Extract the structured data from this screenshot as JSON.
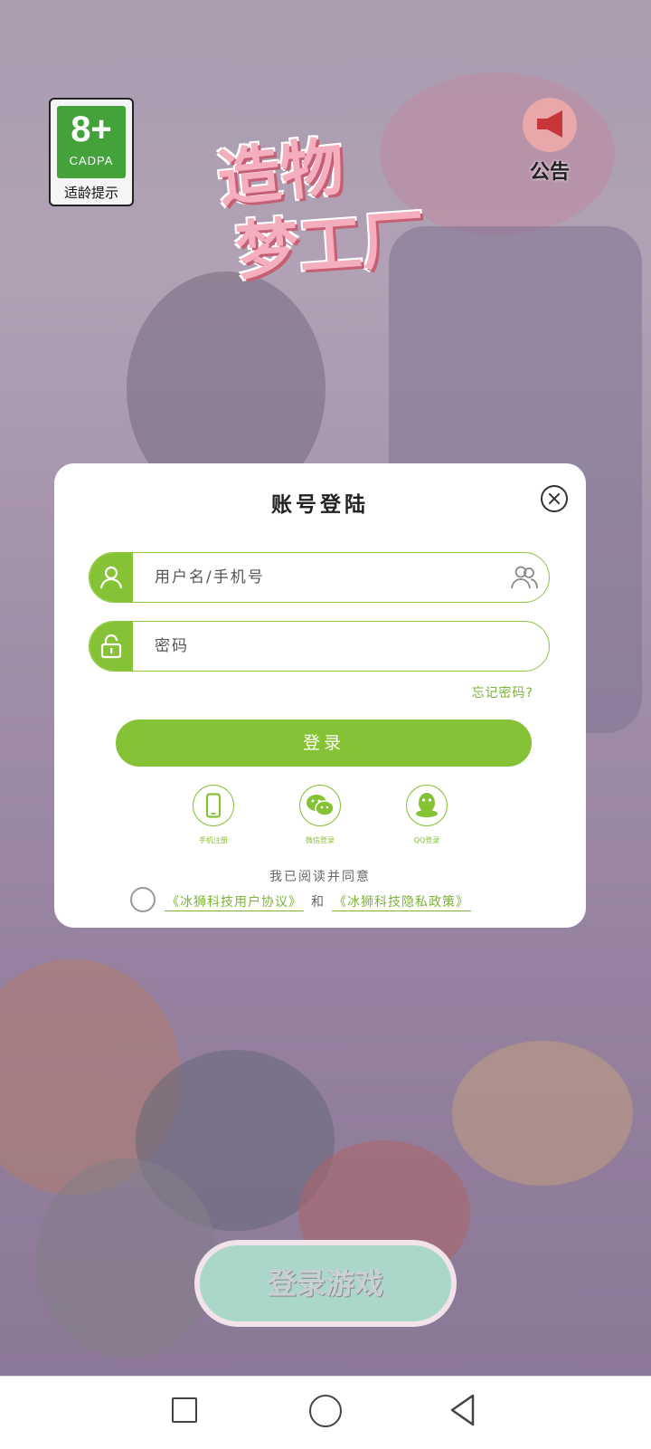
{
  "age_badge": {
    "age": "8+",
    "org": "CADPA",
    "tip": "适龄提示"
  },
  "logo": {
    "line1": "造物",
    "line2": "梦工厂"
  },
  "announcement": {
    "label": "公告"
  },
  "login_modal": {
    "title": "账号登陆",
    "username_placeholder": "用户名/手机号",
    "password_placeholder": "密码",
    "forgot_password": "忘记密码?",
    "login_button": "登录",
    "social": [
      {
        "label": "手机注册",
        "icon": "phone-icon"
      },
      {
        "label": "微信登录",
        "icon": "wechat-icon"
      },
      {
        "label": "QQ登录",
        "icon": "qq-icon"
      }
    ],
    "agree_text": "我已阅读并同意",
    "user_agreement": "《冰狮科技用户协议》",
    "and_text": "和",
    "privacy_policy": "《冰狮科技隐私政策》"
  },
  "game_login_button": "登录游戏",
  "colors": {
    "accent": "#86c235",
    "link": "#7db33b"
  }
}
